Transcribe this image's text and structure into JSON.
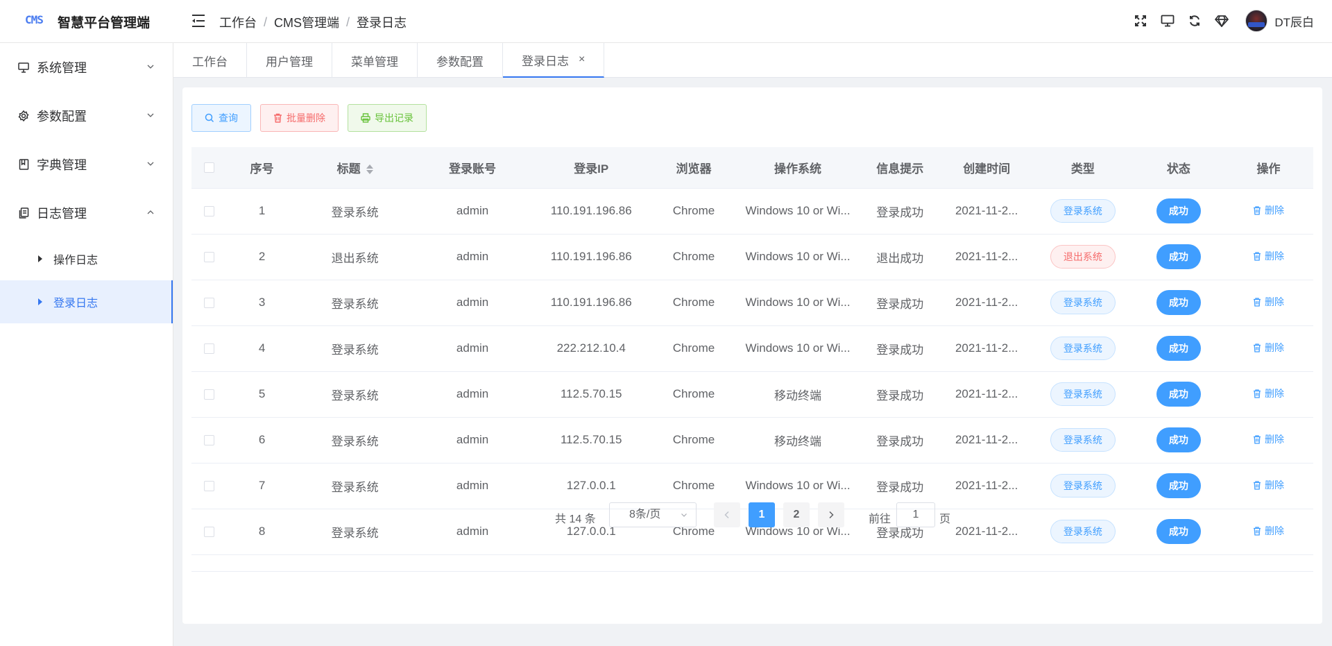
{
  "header": {
    "logo": "CMS",
    "title": "智慧平台管理端",
    "breadcrumb": [
      "工作台",
      "CMS管理端",
      "登录日志"
    ],
    "username": "DT辰白"
  },
  "sidebar": {
    "menus": [
      {
        "label": "系统管理",
        "icon": "monitor-icon",
        "expanded": false
      },
      {
        "label": "参数配置",
        "icon": "gear-icon",
        "expanded": false
      },
      {
        "label": "字典管理",
        "icon": "book-icon",
        "expanded": false
      },
      {
        "label": "日志管理",
        "icon": "document-icon",
        "expanded": true
      }
    ],
    "submenu": [
      {
        "label": "操作日志",
        "active": false
      },
      {
        "label": "登录日志",
        "active": true
      }
    ]
  },
  "tabs": [
    {
      "label": "工作台"
    },
    {
      "label": "用户管理"
    },
    {
      "label": "菜单管理"
    },
    {
      "label": "参数配置"
    },
    {
      "label": "登录日志",
      "active": true,
      "close": "×"
    }
  ],
  "toolbar": {
    "query_label": "查询",
    "batch_delete_label": "批量删除",
    "export_label": "导出记录"
  },
  "table": {
    "headers": [
      "序号",
      "标题",
      "登录账号",
      "登录IP",
      "浏览器",
      "操作系统",
      "信息提示",
      "创建时间",
      "类型",
      "状态",
      "操作"
    ],
    "delete_label": "删除",
    "rows": [
      {
        "no": "1",
        "title": "登录系统",
        "account": "admin",
        "ip": "110.191.196.86",
        "browser": "Chrome",
        "os": "Windows 10 or Wi...",
        "message": "登录成功",
        "created": "2021-11-2...",
        "type": "登录系统",
        "type_kind": "login",
        "status": "成功"
      },
      {
        "no": "2",
        "title": "退出系统",
        "account": "admin",
        "ip": "110.191.196.86",
        "browser": "Chrome",
        "os": "Windows 10 or Wi...",
        "message": "退出成功",
        "created": "2021-11-2...",
        "type": "退出系统",
        "type_kind": "logout",
        "status": "成功"
      },
      {
        "no": "3",
        "title": "登录系统",
        "account": "admin",
        "ip": "110.191.196.86",
        "browser": "Chrome",
        "os": "Windows 10 or Wi...",
        "message": "登录成功",
        "created": "2021-11-2...",
        "type": "登录系统",
        "type_kind": "login",
        "status": "成功"
      },
      {
        "no": "4",
        "title": "登录系统",
        "account": "admin",
        "ip": "222.212.10.4",
        "browser": "Chrome",
        "os": "Windows 10 or Wi...",
        "message": "登录成功",
        "created": "2021-11-2...",
        "type": "登录系统",
        "type_kind": "login",
        "status": "成功"
      },
      {
        "no": "5",
        "title": "登录系统",
        "account": "admin",
        "ip": "112.5.70.15",
        "browser": "Chrome",
        "os": "移动终端",
        "message": "登录成功",
        "created": "2021-11-2...",
        "type": "登录系统",
        "type_kind": "login",
        "status": "成功"
      },
      {
        "no": "6",
        "title": "登录系统",
        "account": "admin",
        "ip": "112.5.70.15",
        "browser": "Chrome",
        "os": "移动终端",
        "message": "登录成功",
        "created": "2021-11-2...",
        "type": "登录系统",
        "type_kind": "login",
        "status": "成功"
      },
      {
        "no": "7",
        "title": "登录系统",
        "account": "admin",
        "ip": "127.0.0.1",
        "browser": "Chrome",
        "os": "Windows 10 or Wi...",
        "message": "登录成功",
        "created": "2021-11-2...",
        "type": "登录系统",
        "type_kind": "login",
        "status": "成功"
      },
      {
        "no": "8",
        "title": "登录系统",
        "account": "admin",
        "ip": "127.0.0.1",
        "browser": "Chrome",
        "os": "Windows 10 or Wi...",
        "message": "登录成功",
        "created": "2021-11-2...",
        "type": "登录系统",
        "type_kind": "login",
        "status": "成功"
      }
    ]
  },
  "pagination": {
    "total_text": "共 14 条",
    "page_size": "8条/页",
    "pages": [
      "1",
      "2"
    ],
    "current_page": "1",
    "goto_label": "前往",
    "goto_value": "1",
    "page_suffix": "页"
  },
  "colors": {
    "primary": "#409eff",
    "active_menu": "#3577f0",
    "danger": "#f56c6c",
    "success": "#67c23a"
  }
}
